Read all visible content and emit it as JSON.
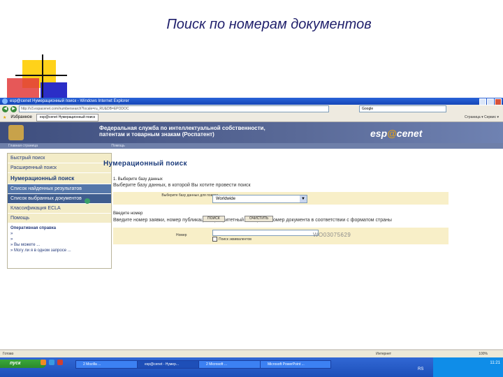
{
  "slide": {
    "title": "Поиск по номерам документов"
  },
  "browser": {
    "title": "esp@cenet Нумерационный поиск - Windows Internet Explorer",
    "url": "http://v3.espacenet.com/numbersearch?locale=ru_RU&DB=EPODOC",
    "search_placeholder": "Google",
    "favorites_label": "Избранное",
    "tab_label": "esp@cenet Нумерационный поиск",
    "tools_label": "Страница ▾  Сервис ▾"
  },
  "page": {
    "header": {
      "line1": "Федеральная служба по интеллектуальной собственности,",
      "line2": "патентам и товарным знакам (Роспатент)",
      "logo_left": "esp",
      "logo_mid": "@",
      "logo_right": "cenet",
      "sub1": "Главная страница",
      "sub2": "Помощь"
    },
    "sidebar": {
      "items": [
        "Быстрый поиск",
        "Расширенный поиск",
        "Нумерационный поиск",
        "Список найденных результатов",
        "Список выбранных документов",
        "Классификация ECLA",
        "Помощь"
      ],
      "help_title": "Оперативная справка",
      "help_lines": [
        "»",
        "»",
        "» Вы можете ...",
        "» Могу ли я в одном запросе ..."
      ]
    },
    "main": {
      "title": "Нумерационный поиск",
      "step1": "1. Выберите базу данных",
      "step1_desc": "Выберите базу данных, в которой Вы хотите провести поиск",
      "db_label": "Выберите базу данных для поиска",
      "db_value": "Worldwide",
      "step2": "Введите номер",
      "step2_desc": "Введите номер заявки, номер публикации, приоритетный номер или номер документа в соответствии с форматом страны",
      "number_label": "Номер",
      "checkbox_label": "Поиск эквивалентов",
      "sample_number": "WO03075629",
      "search_button": "ПОИСК",
      "clear_button": "ОЧИСТИТЬ"
    }
  },
  "statusbar": {
    "left": "Готово",
    "right": "Интернет",
    "zoom": "100%"
  },
  "taskbar": {
    "start": "пуск",
    "buttons": [
      "2 Mozilla ...",
      "esp@cenet - Нумер...",
      "2 Microsoft ...",
      "Microsoft PowerPoint ..."
    ],
    "lang": "RS",
    "time": "11:21"
  }
}
